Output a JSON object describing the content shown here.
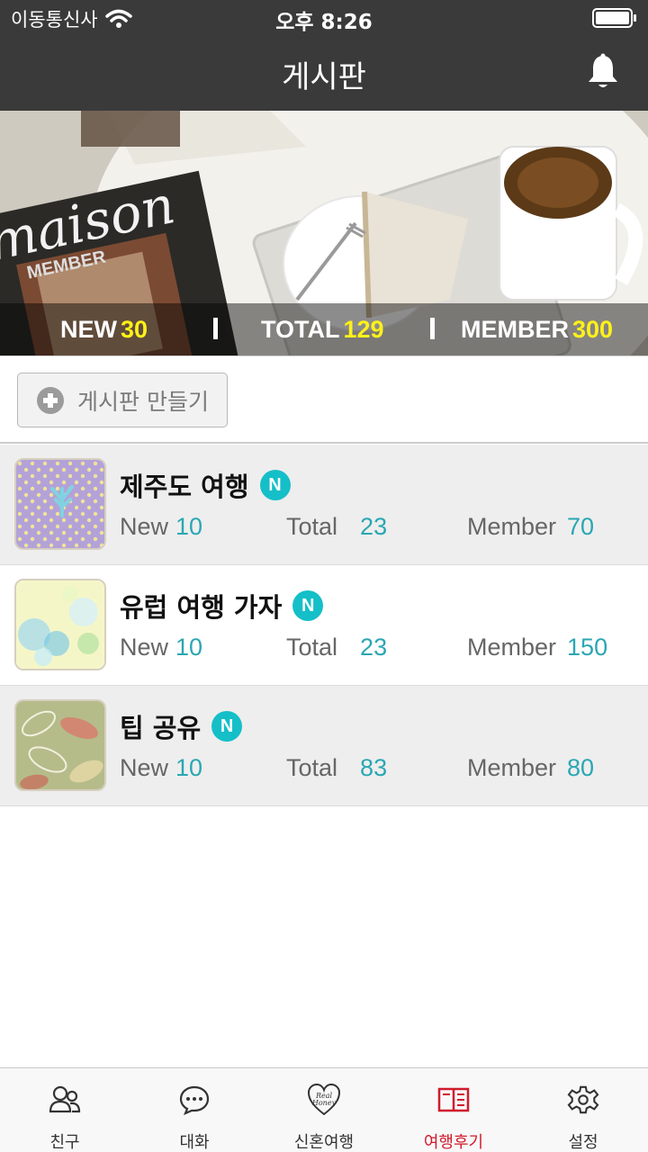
{
  "status_bar": {
    "carrier": "이동통신사",
    "time": "오후 8:26"
  },
  "header": {
    "title": "게시판"
  },
  "banner": {
    "stats": [
      {
        "label": "NEW",
        "value": "30"
      },
      {
        "label": "TOTAL",
        "value": "129"
      },
      {
        "label": "MEMBER",
        "value": "300"
      }
    ],
    "photo_text": {
      "magazine": "maison",
      "member": "MEMBER"
    }
  },
  "create_board": {
    "label": "게시판 만들기"
  },
  "boards": [
    {
      "title": "제주도 여행",
      "badge": "N",
      "new_label": "New",
      "new": "10",
      "total_label": "Total",
      "total": "23",
      "member_label": "Member",
      "member": "70"
    },
    {
      "title": "유럽 여행 가자",
      "badge": "N",
      "new_label": "New",
      "new": "10",
      "total_label": "Total",
      "total": "23",
      "member_label": "Member",
      "member": "150"
    },
    {
      "title": "팁 공유",
      "badge": "N",
      "new_label": "New",
      "new": "10",
      "total_label": "Total",
      "total": "83",
      "member_label": "Member",
      "member": "80"
    }
  ],
  "tabs": [
    {
      "label": "친구",
      "icon": "friends-icon"
    },
    {
      "label": "대화",
      "icon": "chat-icon"
    },
    {
      "label": "신혼여행",
      "icon": "honeymoon-heart-icon",
      "icon_text": "Real Honey"
    },
    {
      "label": "여행후기",
      "icon": "travel-review-book-icon",
      "active": true
    },
    {
      "label": "설정",
      "icon": "settings-gear-icon"
    }
  ],
  "colors": {
    "header_bg": "#3a3a3a",
    "stat_number": "#fff11a",
    "badge": "#15bfc8",
    "meta_value": "#2aa7b3",
    "active_tab": "#d01b2c"
  }
}
